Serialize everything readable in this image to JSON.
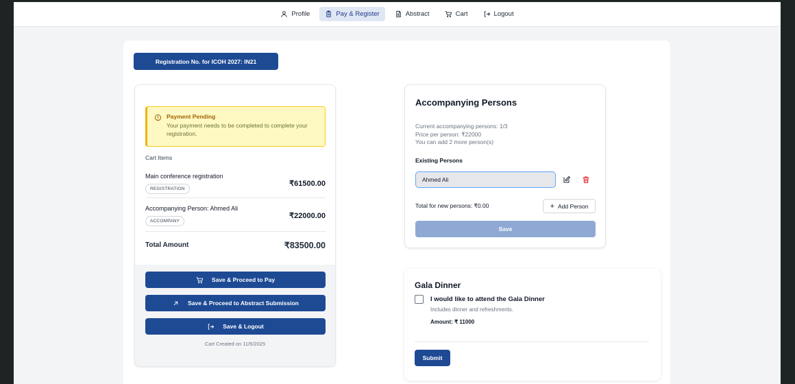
{
  "nav": {
    "items": [
      {
        "label": "Profile",
        "icon": "user-icon",
        "active": false
      },
      {
        "label": "Pay & Register",
        "icon": "clipboard-icon",
        "active": true
      },
      {
        "label": "Abstract",
        "icon": "document-icon",
        "active": false
      },
      {
        "label": "Cart",
        "icon": "cart-icon",
        "active": false
      },
      {
        "label": "Logout",
        "icon": "logout-icon",
        "active": false
      }
    ]
  },
  "registration": {
    "label": "Registration No. for ICOH 2027: IN21"
  },
  "alert": {
    "title": "Payment Pending",
    "body": "Your payment needs to be completed to complete your registration."
  },
  "cart": {
    "label": "Cart Items",
    "items": [
      {
        "name": "Main conference registration",
        "badge": "REGISTRATION",
        "price": "₹61500.00"
      },
      {
        "name": "Accompanying Person: Ahmed Ali",
        "badge": "ACCOMPANY",
        "price": "₹22000.00"
      }
    ],
    "total_label": "Total Amount",
    "total_value": "₹83500.00",
    "actions": {
      "pay": "Save & Proceed to Pay",
      "abstract": "Save & Proceed to Abstract Submission",
      "logout": "Save & Logout"
    },
    "created": "Cart Created on 11/5/2025"
  },
  "accompanying": {
    "title": "Accompanying Persons",
    "current": "Current accompanying persons: 1/3",
    "price": "Price per person: ₹22000",
    "can_add": "You can add 2 more person(s)",
    "existing_label": "Existing Persons",
    "person_name": "Ahmed Ali",
    "total_new": "Total for new persons: ₹0.00",
    "add_label": "Add Person",
    "save_label": "Save"
  },
  "gala": {
    "title": "Gala Dinner",
    "checked": false,
    "label": "I would like to attend the Gala Dinner",
    "desc": "Includes dinner and refreshments.",
    "amount": "Amount: ₹ 11000",
    "submit": "Submit"
  },
  "colors": {
    "primary": "#1e4a94",
    "primary_disabled": "#8fa9d4",
    "warning_bg": "#fef9c3",
    "warning_border": "#eab308",
    "delete": "#dc2626"
  }
}
